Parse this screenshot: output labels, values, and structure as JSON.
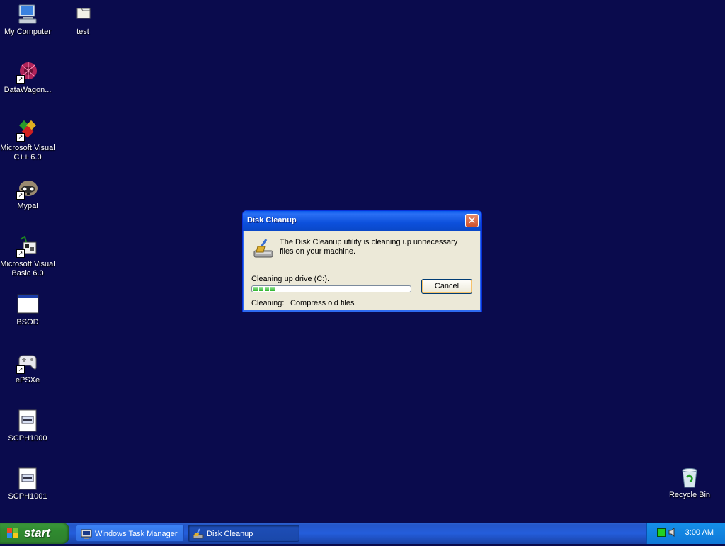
{
  "desktop": {
    "icons": [
      {
        "label": "My Computer",
        "icon": "my-computer-icon"
      },
      {
        "label": "test",
        "icon": "folder-icon"
      },
      {
        "label": "DataWagon...",
        "icon": "datawagon-icon"
      },
      {
        "label": "Microsoft Visual C++ 6.0",
        "icon": "visual-cpp-icon"
      },
      {
        "label": "Mypal",
        "icon": "mypal-icon"
      },
      {
        "label": "Microsoft Visual Basic 6.0",
        "icon": "visual-basic-icon"
      },
      {
        "label": "BSOD",
        "icon": "window-icon"
      },
      {
        "label": "ePSXe",
        "icon": "gamepad-icon"
      },
      {
        "label": "SCPH1000",
        "icon": "bin-file-icon"
      },
      {
        "label": "SCPH1001",
        "icon": "bin-file-icon"
      },
      {
        "label": "Recycle Bin",
        "icon": "recycle-bin-icon"
      }
    ]
  },
  "dialog": {
    "title": "Disk Cleanup",
    "message": "The Disk Cleanup utility is cleaning up unnecessary files on your machine.",
    "drive_label": "Cleaning up drive  (C:).",
    "progress": 0.16,
    "cancel_label": "Cancel",
    "cleaning_label": "Cleaning:",
    "cleaning_value": "Compress old files",
    "close_glyph": "✕"
  },
  "taskbar": {
    "start_label": "start",
    "buttons": [
      {
        "label": "Windows Task Manager",
        "icon": "task-manager-icon",
        "active": false
      },
      {
        "label": "Disk Cleanup",
        "icon": "disk-cleanup-icon",
        "active": true
      }
    ],
    "clock": "3:00 AM"
  },
  "colors": {
    "desktop": "#0a0b4d",
    "title_bar": "#0a5bec",
    "taskbar": "#245edc",
    "start": "#3c9a3c"
  }
}
